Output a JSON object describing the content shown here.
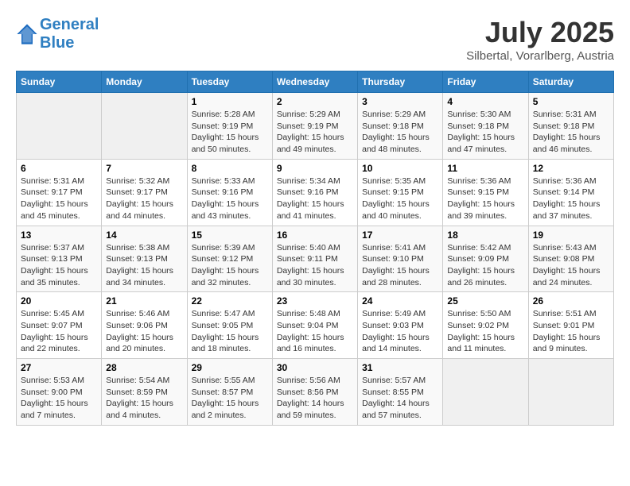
{
  "header": {
    "logo_line1": "General",
    "logo_line2": "Blue",
    "month": "July 2025",
    "location": "Silbertal, Vorarlberg, Austria"
  },
  "weekdays": [
    "Sunday",
    "Monday",
    "Tuesday",
    "Wednesday",
    "Thursday",
    "Friday",
    "Saturday"
  ],
  "weeks": [
    [
      {
        "day": "",
        "info": ""
      },
      {
        "day": "",
        "info": ""
      },
      {
        "day": "1",
        "info": "Sunrise: 5:28 AM\nSunset: 9:19 PM\nDaylight: 15 hours\nand 50 minutes."
      },
      {
        "day": "2",
        "info": "Sunrise: 5:29 AM\nSunset: 9:19 PM\nDaylight: 15 hours\nand 49 minutes."
      },
      {
        "day": "3",
        "info": "Sunrise: 5:29 AM\nSunset: 9:18 PM\nDaylight: 15 hours\nand 48 minutes."
      },
      {
        "day": "4",
        "info": "Sunrise: 5:30 AM\nSunset: 9:18 PM\nDaylight: 15 hours\nand 47 minutes."
      },
      {
        "day": "5",
        "info": "Sunrise: 5:31 AM\nSunset: 9:18 PM\nDaylight: 15 hours\nand 46 minutes."
      }
    ],
    [
      {
        "day": "6",
        "info": "Sunrise: 5:31 AM\nSunset: 9:17 PM\nDaylight: 15 hours\nand 45 minutes."
      },
      {
        "day": "7",
        "info": "Sunrise: 5:32 AM\nSunset: 9:17 PM\nDaylight: 15 hours\nand 44 minutes."
      },
      {
        "day": "8",
        "info": "Sunrise: 5:33 AM\nSunset: 9:16 PM\nDaylight: 15 hours\nand 43 minutes."
      },
      {
        "day": "9",
        "info": "Sunrise: 5:34 AM\nSunset: 9:16 PM\nDaylight: 15 hours\nand 41 minutes."
      },
      {
        "day": "10",
        "info": "Sunrise: 5:35 AM\nSunset: 9:15 PM\nDaylight: 15 hours\nand 40 minutes."
      },
      {
        "day": "11",
        "info": "Sunrise: 5:36 AM\nSunset: 9:15 PM\nDaylight: 15 hours\nand 39 minutes."
      },
      {
        "day": "12",
        "info": "Sunrise: 5:36 AM\nSunset: 9:14 PM\nDaylight: 15 hours\nand 37 minutes."
      }
    ],
    [
      {
        "day": "13",
        "info": "Sunrise: 5:37 AM\nSunset: 9:13 PM\nDaylight: 15 hours\nand 35 minutes."
      },
      {
        "day": "14",
        "info": "Sunrise: 5:38 AM\nSunset: 9:13 PM\nDaylight: 15 hours\nand 34 minutes."
      },
      {
        "day": "15",
        "info": "Sunrise: 5:39 AM\nSunset: 9:12 PM\nDaylight: 15 hours\nand 32 minutes."
      },
      {
        "day": "16",
        "info": "Sunrise: 5:40 AM\nSunset: 9:11 PM\nDaylight: 15 hours\nand 30 minutes."
      },
      {
        "day": "17",
        "info": "Sunrise: 5:41 AM\nSunset: 9:10 PM\nDaylight: 15 hours\nand 28 minutes."
      },
      {
        "day": "18",
        "info": "Sunrise: 5:42 AM\nSunset: 9:09 PM\nDaylight: 15 hours\nand 26 minutes."
      },
      {
        "day": "19",
        "info": "Sunrise: 5:43 AM\nSunset: 9:08 PM\nDaylight: 15 hours\nand 24 minutes."
      }
    ],
    [
      {
        "day": "20",
        "info": "Sunrise: 5:45 AM\nSunset: 9:07 PM\nDaylight: 15 hours\nand 22 minutes."
      },
      {
        "day": "21",
        "info": "Sunrise: 5:46 AM\nSunset: 9:06 PM\nDaylight: 15 hours\nand 20 minutes."
      },
      {
        "day": "22",
        "info": "Sunrise: 5:47 AM\nSunset: 9:05 PM\nDaylight: 15 hours\nand 18 minutes."
      },
      {
        "day": "23",
        "info": "Sunrise: 5:48 AM\nSunset: 9:04 PM\nDaylight: 15 hours\nand 16 minutes."
      },
      {
        "day": "24",
        "info": "Sunrise: 5:49 AM\nSunset: 9:03 PM\nDaylight: 15 hours\nand 14 minutes."
      },
      {
        "day": "25",
        "info": "Sunrise: 5:50 AM\nSunset: 9:02 PM\nDaylight: 15 hours\nand 11 minutes."
      },
      {
        "day": "26",
        "info": "Sunrise: 5:51 AM\nSunset: 9:01 PM\nDaylight: 15 hours\nand 9 minutes."
      }
    ],
    [
      {
        "day": "27",
        "info": "Sunrise: 5:53 AM\nSunset: 9:00 PM\nDaylight: 15 hours\nand 7 minutes."
      },
      {
        "day": "28",
        "info": "Sunrise: 5:54 AM\nSunset: 8:59 PM\nDaylight: 15 hours\nand 4 minutes."
      },
      {
        "day": "29",
        "info": "Sunrise: 5:55 AM\nSunset: 8:57 PM\nDaylight: 15 hours\nand 2 minutes."
      },
      {
        "day": "30",
        "info": "Sunrise: 5:56 AM\nSunset: 8:56 PM\nDaylight: 14 hours\nand 59 minutes."
      },
      {
        "day": "31",
        "info": "Sunrise: 5:57 AM\nSunset: 8:55 PM\nDaylight: 14 hours\nand 57 minutes."
      },
      {
        "day": "",
        "info": ""
      },
      {
        "day": "",
        "info": ""
      }
    ]
  ]
}
